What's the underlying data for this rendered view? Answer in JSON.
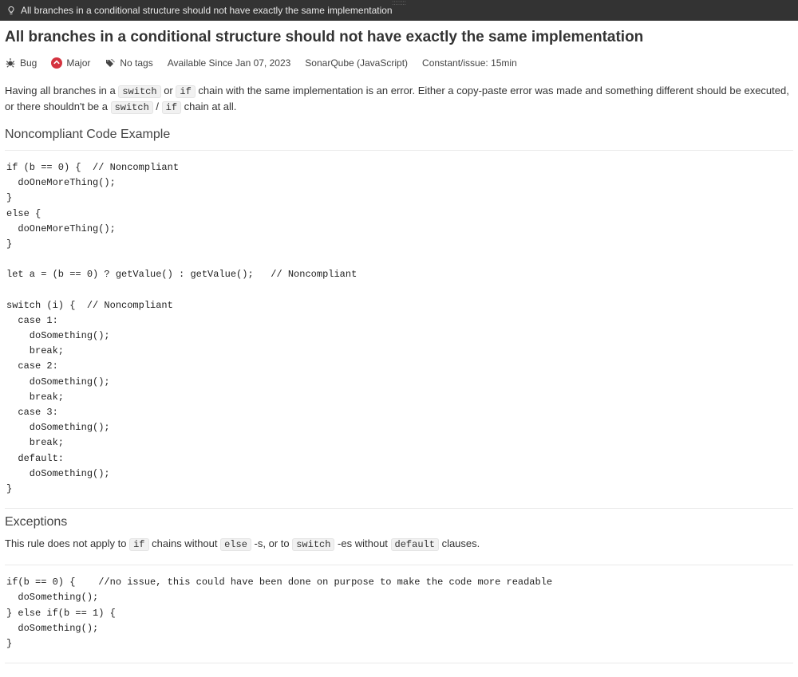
{
  "topbar": {
    "title": "All branches in a conditional structure should not have exactly the same implementation"
  },
  "page": {
    "title": "All branches in a conditional structure should not have exactly the same implementation"
  },
  "meta": {
    "type": "Bug",
    "severity": "Major",
    "tags": "No tags",
    "available": "Available Since Jan 07, 2023",
    "source": "SonarQube (JavaScript)",
    "effort": "Constant/issue: 15min"
  },
  "desc": {
    "p1a": "Having all branches in a ",
    "c1": "switch",
    "p1b": " or ",
    "c2": "if",
    "p1c": " chain with the same implementation is an error. Either a copy-paste error was made and something different should be executed, or there shouldn't be a ",
    "c3": "switch",
    "p1d": " / ",
    "c4": "if",
    "p1e": " chain at all."
  },
  "sections": {
    "noncompliant": "Noncompliant Code Example",
    "exceptions": "Exceptions"
  },
  "code1": "if (b == 0) {  // Noncompliant\n  doOneMoreThing();\n}\nelse {\n  doOneMoreThing();\n}\n\nlet a = (b == 0) ? getValue() : getValue();   // Noncompliant\n\nswitch (i) {  // Noncompliant\n  case 1:\n    doSomething();\n    break;\n  case 2:\n    doSomething();\n    break;\n  case 3:\n    doSomething();\n    break;\n  default:\n    doSomething();\n}",
  "exc": {
    "p1a": "This rule does not apply to ",
    "c1": "if",
    "p1b": " chains without ",
    "c2": "else",
    "p1c": " -s, or to ",
    "c3": "switch",
    "p1d": " -es without ",
    "c4": "default",
    "p1e": " clauses."
  },
  "code2": "if(b == 0) {    //no issue, this could have been done on purpose to make the code more readable\n  doSomething();\n} else if(b == 1) {\n  doSomething();\n}"
}
